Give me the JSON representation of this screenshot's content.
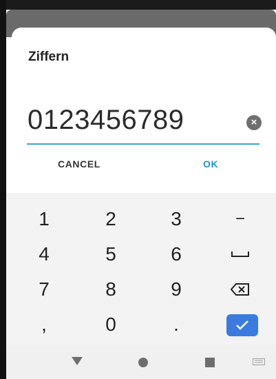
{
  "dialog": {
    "title": "Ziffern",
    "value": "0123456789",
    "cancel_label": "CANCEL",
    "ok_label": "OK"
  },
  "keyboard": {
    "rows": [
      [
        "1",
        "2",
        "3",
        "−"
      ],
      [
        "4",
        "5",
        "6",
        "space"
      ],
      [
        "7",
        "8",
        "9",
        "backspace"
      ],
      [
        ",",
        "0",
        ".",
        "done"
      ]
    ],
    "accent_color": "#3b7be0"
  },
  "nav": {
    "icons": [
      "back-icon",
      "home-icon",
      "recents-icon",
      "keyboard-icon"
    ]
  },
  "colors": {
    "field_underline": "#38a6c7",
    "ok_text": "#2196c8"
  }
}
